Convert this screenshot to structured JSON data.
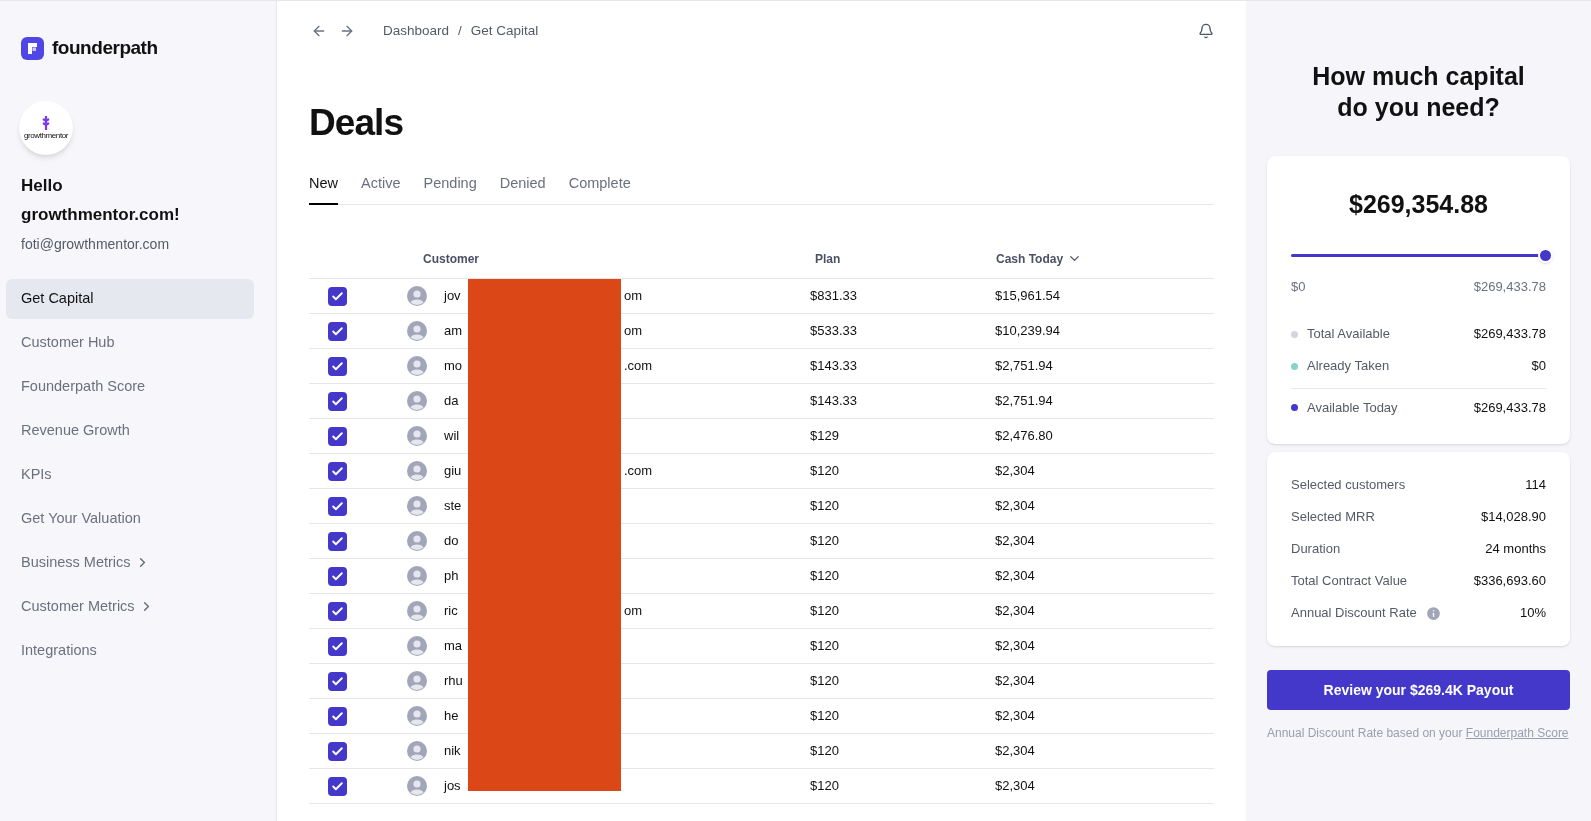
{
  "brand": {
    "name": "founderpath"
  },
  "user": {
    "greeting": "Hello growthmentor.com!",
    "email": "foti@growthmentor.com",
    "logo_text": "growthmentor"
  },
  "sidebar": {
    "items": [
      {
        "label": "Get Capital",
        "selected": true,
        "expandable": false
      },
      {
        "label": "Customer Hub",
        "selected": false,
        "expandable": false
      },
      {
        "label": "Founderpath Score",
        "selected": false,
        "expandable": false
      },
      {
        "label": "Revenue Growth",
        "selected": false,
        "expandable": false
      },
      {
        "label": "KPIs",
        "selected": false,
        "expandable": false
      },
      {
        "label": "Get Your Valuation",
        "selected": false,
        "expandable": false
      },
      {
        "label": "Business Metrics",
        "selected": false,
        "expandable": true
      },
      {
        "label": "Customer Metrics",
        "selected": false,
        "expandable": true
      },
      {
        "label": "Integrations",
        "selected": false,
        "expandable": false
      }
    ]
  },
  "breadcrumb": [
    "Dashboard",
    "Get Capital"
  ],
  "breadcrumb_separator": "/",
  "page_title": "Deals",
  "tabs": [
    {
      "label": "New",
      "selected": true
    },
    {
      "label": "Active",
      "selected": false
    },
    {
      "label": "Pending",
      "selected": false
    },
    {
      "label": "Denied",
      "selected": false
    },
    {
      "label": "Complete",
      "selected": false
    }
  ],
  "table": {
    "columns": [
      "Customer",
      "Plan",
      "Cash Today"
    ],
    "rows": [
      {
        "checked": true,
        "customer_start": "jov",
        "customer_end": "om",
        "plan": "$831.33",
        "cash_today": "$15,961.54"
      },
      {
        "checked": true,
        "customer_start": "am",
        "customer_end": "om",
        "plan": "$533.33",
        "cash_today": "$10,239.94"
      },
      {
        "checked": true,
        "customer_start": "mo",
        "customer_end": ".com",
        "plan": "$143.33",
        "cash_today": "$2,751.94"
      },
      {
        "checked": true,
        "customer_start": "da",
        "customer_end": "",
        "plan": "$143.33",
        "cash_today": "$2,751.94"
      },
      {
        "checked": true,
        "customer_start": "wil",
        "customer_end": "",
        "plan": "$129",
        "cash_today": "$2,476.80"
      },
      {
        "checked": true,
        "customer_start": "giu",
        "customer_end": ".com",
        "plan": "$120",
        "cash_today": "$2,304"
      },
      {
        "checked": true,
        "customer_start": "ste",
        "customer_end": "",
        "plan": "$120",
        "cash_today": "$2,304"
      },
      {
        "checked": true,
        "customer_start": "do",
        "customer_end": "",
        "plan": "$120",
        "cash_today": "$2,304"
      },
      {
        "checked": true,
        "customer_start": "ph",
        "customer_end": "",
        "plan": "$120",
        "cash_today": "$2,304"
      },
      {
        "checked": true,
        "customer_start": "ric",
        "customer_end": "om",
        "plan": "$120",
        "cash_today": "$2,304"
      },
      {
        "checked": true,
        "customer_start": "ma",
        "customer_end": "",
        "plan": "$120",
        "cash_today": "$2,304"
      },
      {
        "checked": true,
        "customer_start": "rhu",
        "customer_end": "",
        "plan": "$120",
        "cash_today": "$2,304"
      },
      {
        "checked": true,
        "customer_start": "he",
        "customer_end": "",
        "plan": "$120",
        "cash_today": "$2,304"
      },
      {
        "checked": true,
        "customer_start": "nik",
        "customer_end": "",
        "plan": "$120",
        "cash_today": "$2,304"
      },
      {
        "checked": true,
        "customer_start": "jos",
        "customer_end": "",
        "plan": "$120",
        "cash_today": "$2,304"
      }
    ]
  },
  "panel": {
    "title": "How much capital do you need?",
    "amount": "$269,354.88",
    "slider": {
      "level": 0.9997,
      "min_label": "$0",
      "max_label": "$269,433.78"
    },
    "legend": [
      {
        "label": "Total Available",
        "value": "$269,433.78",
        "color": "#d4d4de"
      },
      {
        "label": "Already Taken",
        "value": "$0",
        "color": "#86d3cb"
      },
      {
        "label": "Available Today",
        "value": "$269,433.78",
        "color": "#4338ca"
      }
    ],
    "summary": [
      {
        "kind": "plain",
        "label": "Selected customers",
        "value": "114"
      },
      {
        "kind": "plain",
        "label": "Selected MRR",
        "value": "$14,028.90"
      },
      {
        "kind": "plain",
        "label": "Duration",
        "value": "24 months"
      },
      {
        "kind": "plain",
        "label": "Total Contract Value",
        "value": "$336,693.60"
      },
      {
        "kind": "info",
        "label": "Annual Discount Rate",
        "value": "10%"
      }
    ],
    "button": "Review your $269.4K Payout",
    "footnote": "Annual Discount Rate based on your",
    "footnote_link": "Founderpath Score"
  }
}
